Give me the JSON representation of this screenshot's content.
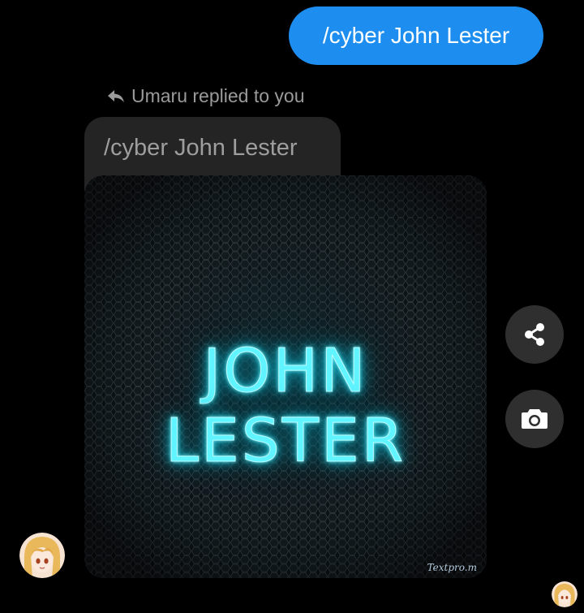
{
  "sent_message": {
    "text": "/cyber John Lester"
  },
  "reply": {
    "indicator_text": "Umaru replied to you",
    "quoted_text": "/cyber John Lester",
    "image": {
      "rendered_text": "JOHN LESTER",
      "watermark": "Textpro.m"
    }
  },
  "actions": {
    "share_icon": "share-icon",
    "camera_icon": "camera-icon"
  },
  "colors": {
    "sent_bubble": "#1d8ef0",
    "background": "#000000",
    "received_bubble": "#242424",
    "neon": "#5ff4ff"
  }
}
